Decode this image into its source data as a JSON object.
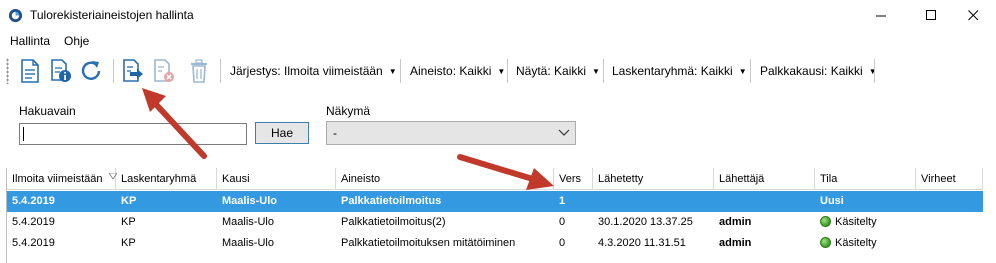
{
  "window": {
    "title": "Tulorekisteriaineistojen hallinta",
    "minimize_glyph": "—",
    "maximize_glyph": "☐",
    "close_glyph": "✕"
  },
  "menu": [
    "Hallinta",
    "Ohje"
  ],
  "toolbar": {
    "icons": [
      "new-document-icon",
      "document-info-icon",
      "refresh-icon",
      "export-document-icon",
      "delete-document-icon",
      "trash-icon"
    ],
    "dropdowns": [
      "Järjestys: Ilmoita viimeistään",
      "Aineisto: Kaikki",
      "Näytä: Kaikki",
      "Laskentaryhmä: Kaikki",
      "Palkkakausi: Kaikki"
    ]
  },
  "search": {
    "label": "Hakuavain",
    "value": "",
    "button_label": "Hae"
  },
  "view": {
    "label": "Näkymä",
    "selected": "-"
  },
  "table": {
    "columns": [
      "Ilmoita viimeistään",
      "Laskentaryhmä",
      "Kausi",
      "Aineisto",
      "Vers",
      "Lähetetty",
      "Lähettäjä",
      "Tila",
      "Virheet"
    ],
    "rows": [
      {
        "ilmoita": "5.4.2019",
        "ryhma": "KP",
        "kausi": "Maalis-Ulo",
        "aineisto": "Palkkatietoilmoitus",
        "vers": "1",
        "lahetetty": "",
        "lahettaja": "",
        "tila": "Uusi",
        "virheet": "",
        "selected": true
      },
      {
        "ilmoita": "5.4.2019",
        "ryhma": "KP",
        "kausi": "Maalis-Ulo",
        "aineisto": "Palkkatietoilmoitus(2)",
        "vers": "0",
        "lahetetty": "30.1.2020 13.37.25",
        "lahettaja": "admin",
        "tila": "Käsitelty",
        "virheet": "",
        "selected": false
      },
      {
        "ilmoita": "5.4.2019",
        "ryhma": "KP",
        "kausi": "Maalis-Ulo",
        "aineisto": "Palkkatietoilmoituksen mitätöiminen",
        "vers": "0",
        "lahetetty": "4.3.2020 11.31.51",
        "lahettaja": "admin",
        "tila": "Käsitelty",
        "virheet": "",
        "selected": false
      }
    ]
  },
  "colors": {
    "selection": "#3399e0",
    "annotation_arrow": "#c0392b",
    "status_ok": "#3a9a25"
  }
}
